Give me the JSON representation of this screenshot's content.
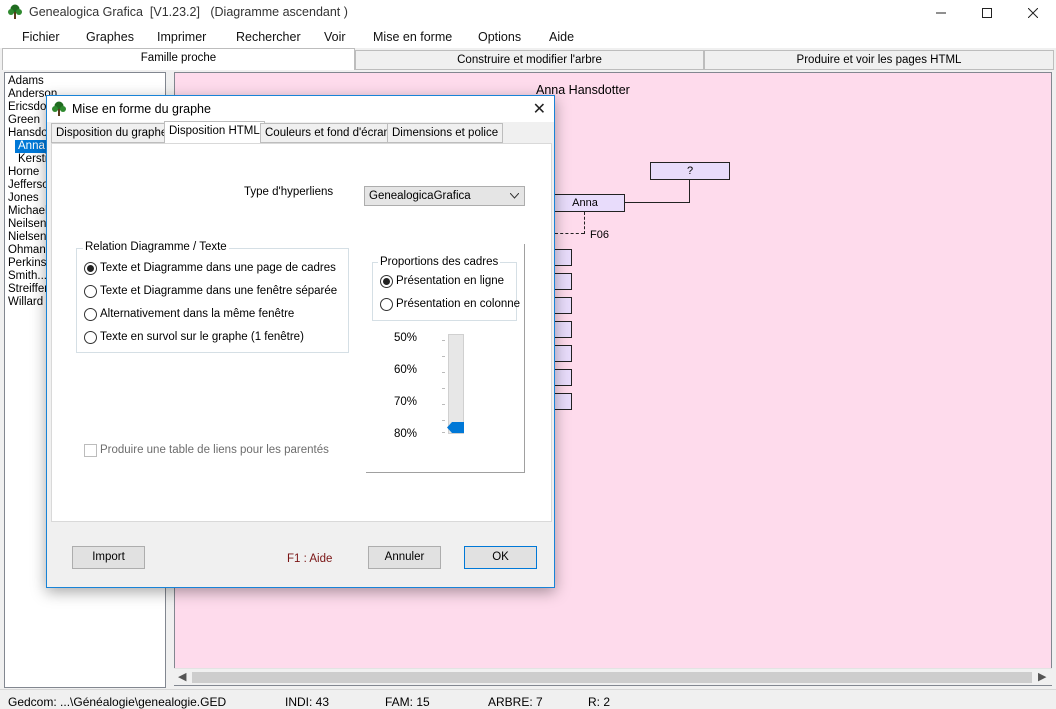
{
  "window": {
    "title": "Genealogica Grafica  [V1.23.2]   (Diagramme ascendant )",
    "minimize_icon": "minimize-icon",
    "maximize_icon": "maximize-icon",
    "close_icon": "close-icon"
  },
  "menu": [
    "Fichier",
    "Graphes",
    "Imprimer",
    "Rechercher",
    "Voir",
    "Mise en forme",
    "Options",
    "Aide"
  ],
  "main_tabs": [
    "Famille proche",
    "Construire et modifier l'arbre",
    "Produire et voir les pages HTML"
  ],
  "names": [
    "Adams",
    "Anderson",
    "Ericsdot",
    "Green",
    "Hansdo",
    "Anna",
    "Kerstin",
    "Horne",
    "Jefferso",
    "Jones",
    "Michael",
    "Neilsen",
    "Nielsen",
    "Ohman",
    "Perkins",
    "Smith...",
    "Streiffer",
    "Willard"
  ],
  "selected_name": "Anna",
  "diagram": {
    "heading": "Anna Hansdotter",
    "person_box": "Anna",
    "father_box": "?",
    "family_code": "F06"
  },
  "dialog": {
    "title": "Mise en forme du graphe",
    "close_label": "✕",
    "tabs": [
      "Disposition du graphe",
      "Disposition HTML",
      "Couleurs et fond d'écran",
      "Dimensions et police"
    ],
    "active_tab": "Disposition HTML",
    "hyperlink_label": "Type d'hyperliens",
    "hyperlink_value": "GenealogicaGrafica",
    "relation_group": {
      "title": "Relation Diagramme / Texte",
      "options": [
        "Texte et Diagramme dans une page de cadres",
        "Texte et Diagramme dans une fenêtre séparée",
        "Alternativement dans la même fenêtre",
        "Texte en survol sur le graphe (1 fenêtre)"
      ],
      "selected": "Texte et Diagramme dans une page de cadres"
    },
    "proportions_group": {
      "title": "Proportions des cadres",
      "options": [
        "Présentation en ligne",
        "Présentation en colonne"
      ],
      "selected": "Présentation en ligne",
      "scale": [
        "50%",
        "60%",
        "70%",
        "80%"
      ],
      "slider_value": "80%"
    },
    "checkbox_label": "Produire une table de liens pour les parentés",
    "buttons": {
      "import": "Import",
      "help": "F1 : Aide",
      "cancel": "Annuler",
      "ok": "OK"
    }
  },
  "status": {
    "gedcom": "Gedcom: ...\\Généalogie\\genealogie.GED",
    "indi": "INDI:  43",
    "fam": "FAM:  15",
    "arbre": "ARBRE:  7",
    "r": "R:  2"
  },
  "colors": {
    "diagram_bg": "#fedbec",
    "person_box": "#e8dcfb",
    "selection": "#0078d7",
    "help_text": "#7a1414"
  }
}
